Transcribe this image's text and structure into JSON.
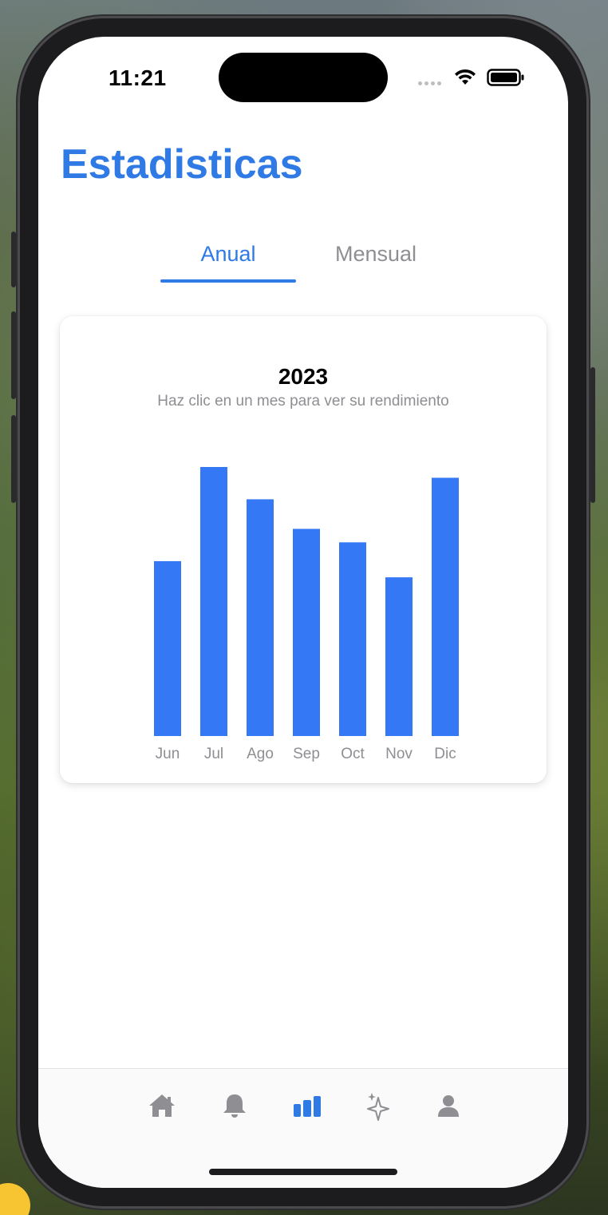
{
  "status_bar": {
    "time": "11:21"
  },
  "page": {
    "title": "Estadisticas"
  },
  "tabs": [
    {
      "label": "Anual",
      "active": true
    },
    {
      "label": "Mensual",
      "active": false
    }
  ],
  "chart_data": {
    "type": "bar",
    "title": "2023",
    "subtitle": "Haz clic en un mes para ver su rendimiento",
    "categories": [
      "Jun",
      "Jul",
      "Ago",
      "Sep",
      "Oct",
      "Nov",
      "Dic"
    ],
    "values": [
      65,
      100,
      88,
      77,
      72,
      59,
      96
    ],
    "ylim": [
      0,
      100
    ],
    "bar_color": "#3478f6",
    "label_color": "#8e8e93"
  },
  "tabbar": {
    "items": [
      {
        "icon": "house-icon",
        "active": false
      },
      {
        "icon": "bell-icon",
        "active": false
      },
      {
        "icon": "chart-bar-icon",
        "active": true
      },
      {
        "icon": "sparkles-icon",
        "active": false
      },
      {
        "icon": "person-icon",
        "active": false
      }
    ],
    "active_color": "#2f7ae5",
    "inactive_color": "#8e8e93"
  }
}
